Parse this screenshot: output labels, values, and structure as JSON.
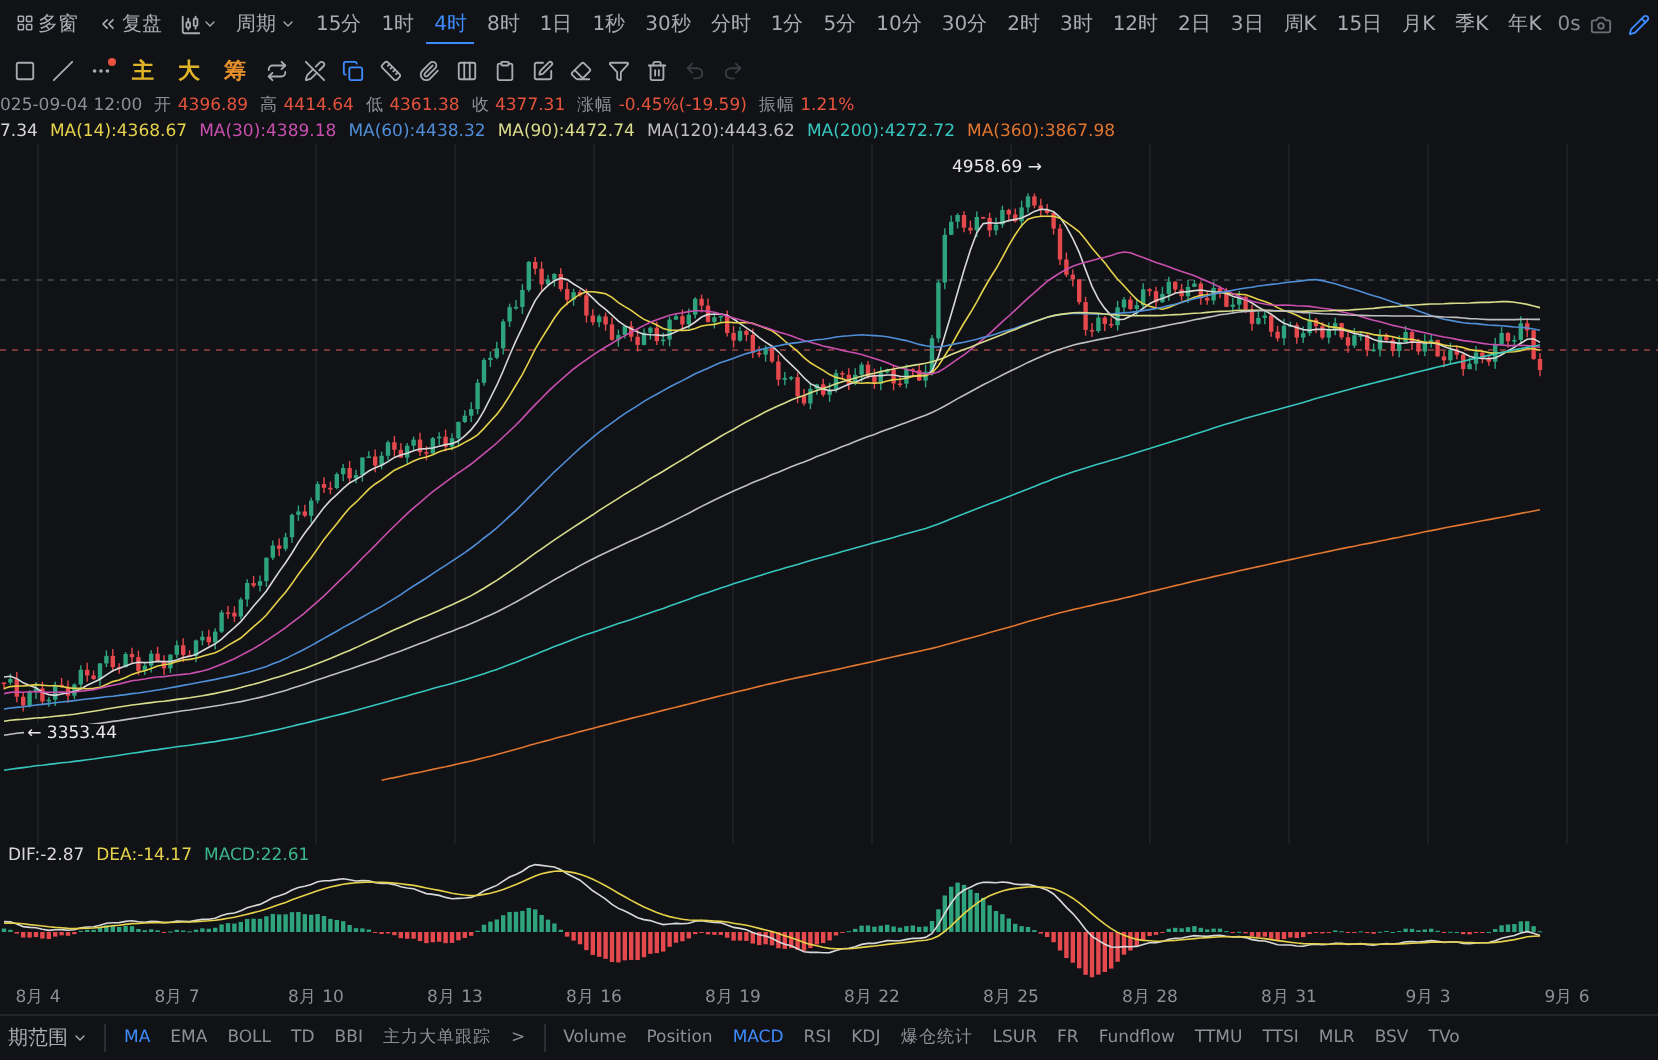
{
  "toolbar": {
    "multi_window": "多窗",
    "replay": "复盘",
    "period_menu": "周期",
    "periods": [
      {
        "label": "15分",
        "selected": false
      },
      {
        "label": "1时",
        "selected": false
      },
      {
        "label": "4时",
        "selected": true
      },
      {
        "label": "8时",
        "selected": false
      },
      {
        "label": "1日",
        "selected": false
      },
      {
        "label": "1秒",
        "selected": false
      },
      {
        "label": "30秒",
        "selected": false
      },
      {
        "label": "分时",
        "selected": false
      },
      {
        "label": "1分",
        "selected": false
      },
      {
        "label": "5分",
        "selected": false
      },
      {
        "label": "10分",
        "selected": false
      },
      {
        "label": "30分",
        "selected": false
      },
      {
        "label": "2时",
        "selected": false
      },
      {
        "label": "3时",
        "selected": false
      },
      {
        "label": "12时",
        "selected": false
      },
      {
        "label": "2日",
        "selected": false
      },
      {
        "label": "3日",
        "selected": false
      },
      {
        "label": "周K",
        "selected": false
      },
      {
        "label": "15日",
        "selected": false
      },
      {
        "label": "月K",
        "selected": false
      },
      {
        "label": "季K",
        "selected": false
      },
      {
        "label": "年K",
        "selected": false
      }
    ],
    "countdown": "0s"
  },
  "draw_toolbar": {
    "chips": [
      {
        "label": "主",
        "color": "#e0b429"
      },
      {
        "label": "大",
        "color": "#e0b429"
      },
      {
        "label": "筹",
        "color": "#e8902a"
      }
    ],
    "tools": [
      {
        "selected": false
      },
      {
        "selected": false
      },
      {
        "selected": true
      },
      {
        "selected": false
      },
      {
        "selected": false
      },
      {
        "selected": false
      },
      {
        "selected": false
      },
      {
        "selected": false
      },
      {
        "selected": false
      },
      {
        "selected": false
      },
      {
        "selected": false
      }
    ],
    "history": [
      {
        "disabled": true
      },
      {
        "disabled": true
      }
    ]
  },
  "ohlc": {
    "time": "025-09-04 12:00",
    "fields": [
      {
        "label": "开",
        "value": "4396.89"
      },
      {
        "label": "高",
        "value": "4414.64"
      },
      {
        "label": "低",
        "value": "4361.38"
      },
      {
        "label": "收",
        "value": "4377.31"
      },
      {
        "label": "涨幅",
        "value": "-0.45%(-19.59)"
      },
      {
        "label": "振幅",
        "value": "1.21%"
      }
    ]
  },
  "moving_averages": [
    {
      "text": "7.34",
      "color": "#d8d8d8"
    },
    {
      "text": "MA(14):4368.67",
      "color": "#e6d24a"
    },
    {
      "text": "MA(30):4389.18",
      "color": "#c94fae"
    },
    {
      "text": "MA(60):4438.32",
      "color": "#4f8fd8"
    },
    {
      "text": "MA(90):4472.74",
      "color": "#d9dc8a"
    },
    {
      "text": "MA(120):4443.62",
      "color": "#bfbfbf"
    },
    {
      "text": "MA(200):4272.72",
      "color": "#36c6bd"
    },
    {
      "text": "MA(360):3867.98",
      "color": "#e0762f"
    }
  ],
  "price_chart": {
    "high_label": "4958.69 →",
    "low_label": "← 3353.44"
  },
  "macd": {
    "legend": [
      {
        "text": "DIF:-2.87",
        "color": "#d8d8d8"
      },
      {
        "text": "DEA:-14.17",
        "color": "#e6d24a"
      },
      {
        "text": "MACD:22.61",
        "color": "#3bb58a"
      }
    ]
  },
  "x_axis": [
    "8月 4",
    "8月 7",
    "8月 10",
    "8月 13",
    "8月 16",
    "8月 19",
    "8月 22",
    "8月 25",
    "8月 28",
    "8月 31",
    "9月 3",
    "9月 6"
  ],
  "bottom_bar": {
    "range": "期范围",
    "main_indicators": [
      {
        "label": "MA",
        "selected": true
      },
      {
        "label": "EMA",
        "selected": false
      },
      {
        "label": "BOLL",
        "selected": false
      },
      {
        "label": "TD",
        "selected": false
      },
      {
        "label": "BBI",
        "selected": false
      },
      {
        "label": "主力大单跟踪",
        "selected": false
      }
    ],
    "more": ">",
    "sub_indicators": [
      {
        "label": "Volume",
        "selected": false
      },
      {
        "label": "Position",
        "selected": false
      },
      {
        "label": "MACD",
        "selected": true
      },
      {
        "label": "RSI",
        "selected": false
      },
      {
        "label": "KDJ",
        "selected": false
      },
      {
        "label": "爆仓统计",
        "selected": false
      },
      {
        "label": "LSUR",
        "selected": false
      },
      {
        "label": "FR",
        "selected": false
      },
      {
        "label": "Fundflow",
        "selected": false
      },
      {
        "label": "TTMU",
        "selected": false
      },
      {
        "label": "TTSI",
        "selected": false
      },
      {
        "label": "MLR",
        "selected": false
      },
      {
        "label": "BSV",
        "selected": false
      },
      {
        "label": "TVo",
        "selected": false
      }
    ]
  }
}
